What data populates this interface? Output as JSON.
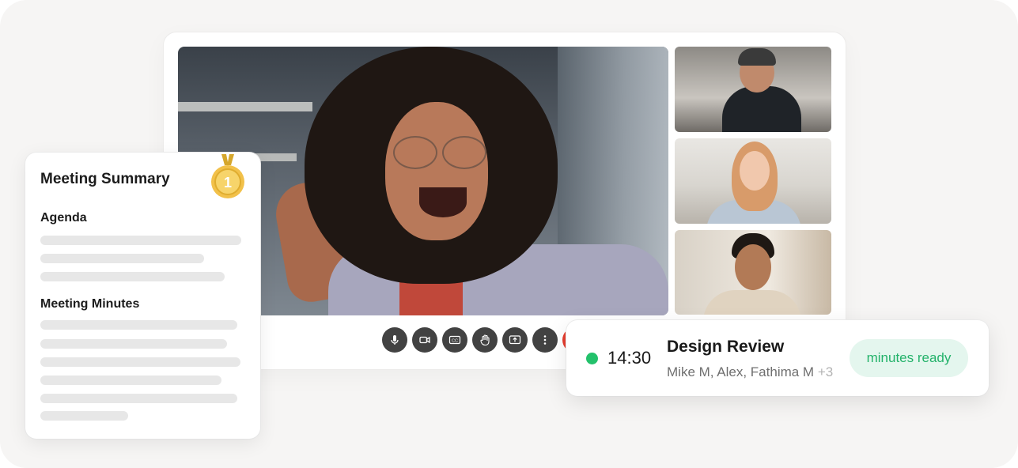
{
  "summary": {
    "title": "Meeting Summary",
    "agenda_label": "Agenda",
    "minutes_label": "Meeting Minutes",
    "medal_text": "1"
  },
  "call": {
    "controls": [
      {
        "icon": "microphone-icon"
      },
      {
        "icon": "camera-icon"
      },
      {
        "icon": "captions-icon"
      },
      {
        "icon": "raise-hand-icon"
      },
      {
        "icon": "share-screen-icon"
      },
      {
        "icon": "more-options-icon"
      },
      {
        "icon": "end-call-icon"
      }
    ]
  },
  "meeting": {
    "time": "14:30",
    "title": "Design Review",
    "participants": "Mike M, Alex, Fathima M",
    "extra_count": "+3",
    "badge": "minutes ready",
    "status_color": "#23c16b"
  }
}
